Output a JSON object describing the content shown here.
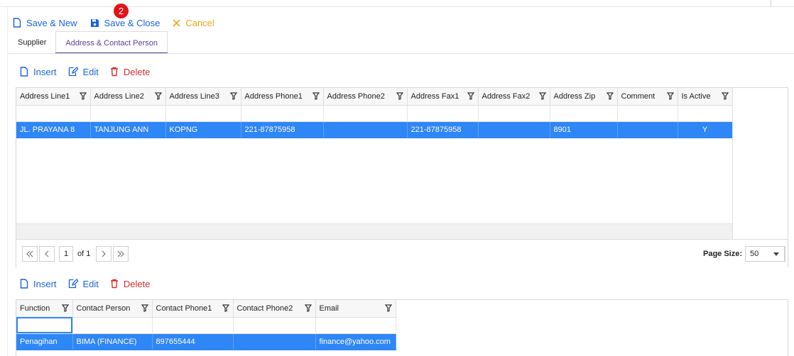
{
  "toolbar": {
    "save_new": "Save & New",
    "save_close": "Save & Close",
    "cancel": "Cancel",
    "badge": "2"
  },
  "tabs": [
    {
      "label": "Supplier"
    },
    {
      "label": "Address & Contact Person"
    }
  ],
  "address_toolbar": {
    "insert": "Insert",
    "edit": "Edit",
    "delete": "Delete"
  },
  "address_grid": {
    "columns": [
      "Address Line1",
      "Address Line2",
      "Address Line3",
      "Address Phone1",
      "Address Phone2",
      "Address Fax1",
      "Address Fax2",
      "Address Zip",
      "Comment",
      "Is Active"
    ],
    "rows": [
      [
        "JL. PRAYANA 8",
        "TANJUNG ANN",
        "KOPNG",
        "221-87875958",
        "",
        "221-87875958",
        "",
        "8901",
        "",
        "Y"
      ]
    ],
    "pager": {
      "page": "1",
      "of_label": "of 1",
      "page_size_label": "Page Size:",
      "page_size": "50"
    }
  },
  "contact_toolbar": {
    "insert": "Insert",
    "edit": "Edit",
    "delete": "Delete"
  },
  "contact_grid": {
    "columns": [
      "Function",
      "Contact Person",
      "Contact Phone1",
      "Contact Phone2",
      "Email"
    ],
    "rows": [
      [
        "Penagihan",
        "BIMA (FINANCE)",
        "897655444",
        "",
        "finance@yahoo.com"
      ]
    ]
  },
  "colors": {
    "accent": "#1a63d8",
    "selection": "#2f86f6",
    "tab_active": "#5b3d98",
    "delete": "#d32f2f",
    "cancel": "#e8a817",
    "badge": "#e3121a"
  },
  "icons": {
    "save_new": "file-icon",
    "save_close": "floppy-icon",
    "cancel": "x-icon",
    "insert": "file-icon",
    "edit": "edit-icon",
    "delete": "trash-icon",
    "filter": "filter-icon"
  }
}
